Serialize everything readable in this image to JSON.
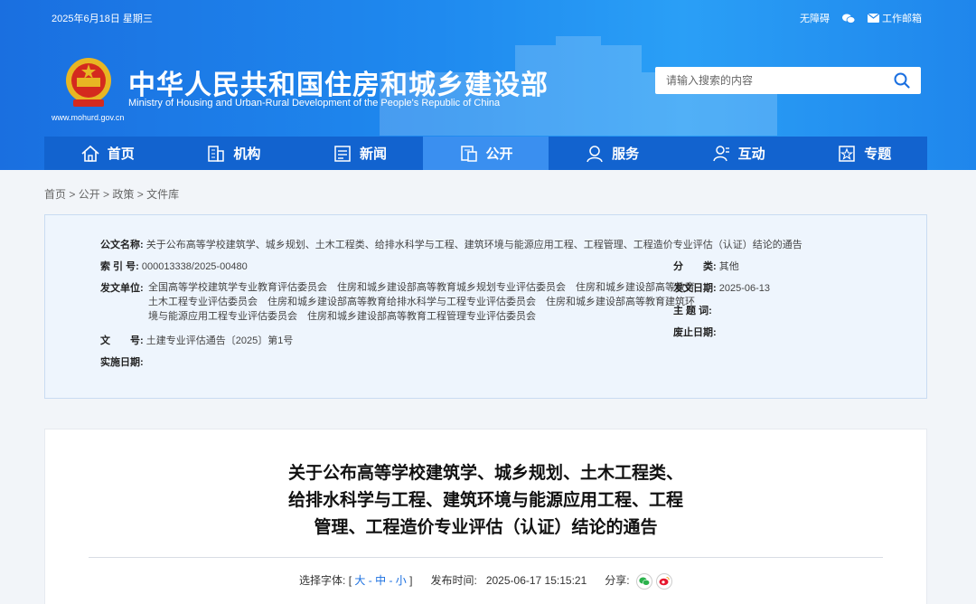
{
  "header": {
    "date": "2025年6月18日 星期三",
    "accessibility": "无障碍",
    "mailbox": "工作邮箱",
    "title": "中华人民共和国住房和城乡建设部",
    "subtitle_en": "Ministry of Housing and Urban-Rural Development of the People's Republic of China",
    "url": "www.mohurd.gov.cn",
    "search_placeholder": "请输入搜索的内容"
  },
  "nav": [
    {
      "label": "首页",
      "icon": "home-icon"
    },
    {
      "label": "机构",
      "icon": "building-icon"
    },
    {
      "label": "新闻",
      "icon": "news-icon"
    },
    {
      "label": "公开",
      "icon": "open-icon",
      "active": true
    },
    {
      "label": "服务",
      "icon": "service-icon"
    },
    {
      "label": "互动",
      "icon": "interact-icon"
    },
    {
      "label": "专题",
      "icon": "topic-icon"
    }
  ],
  "breadcrumb": [
    "首页",
    "公开",
    "政策",
    "文件库"
  ],
  "meta": {
    "name_label": "公文名称:",
    "name_value": "关于公布高等学校建筑学、城乡规划、土木工程类、给排水科学与工程、建筑环境与能源应用工程、工程管理、工程造价专业评估（认证）结论的通告",
    "index_label": "索 引 号:",
    "index_value": "000013338/2025-00480",
    "category_label": "分　　类:",
    "category_value": "其他",
    "issuer_label": "发文单位:",
    "issuer_value": "全国高等学校建筑学专业教育评估委员会　住房和城乡建设部高等教育城乡规划专业评估委员会　住房和城乡建设部高等教育土木工程专业评估委员会　住房和城乡建设部高等教育给排水科学与工程专业评估委员会　住房和城乡建设部高等教育建筑环境与能源应用工程专业评估委员会　住房和城乡建设部高等教育工程管理专业评估委员会",
    "issue_date_label": "发文日期:",
    "issue_date_value": "2025-06-13",
    "keywords_label": "主 题 词:",
    "docno_label": "文　　号:",
    "docno_value": "土建专业评估通告〔2025〕第1号",
    "abolish_label": "废止日期:",
    "effective_label": "实施日期:"
  },
  "article": {
    "title_lines": [
      "关于公布高等学校建筑学、城乡规划、土木工程类、",
      "给排水科学与工程、建筑环境与能源应用工程、工程",
      "管理、工程造价专业评估（认证）结论的通告"
    ],
    "font_label": "选择字体:",
    "size_large": "大",
    "size_medium": "中",
    "size_small": "小",
    "publish_label": "发布时间:",
    "publish_time": "2025-06-17 15:15:21",
    "share_label": "分享:"
  },
  "colors": {
    "header_blue": "#1f86ec",
    "nav_blue": "#1263cf",
    "nav_active": "#3a8ff0"
  }
}
